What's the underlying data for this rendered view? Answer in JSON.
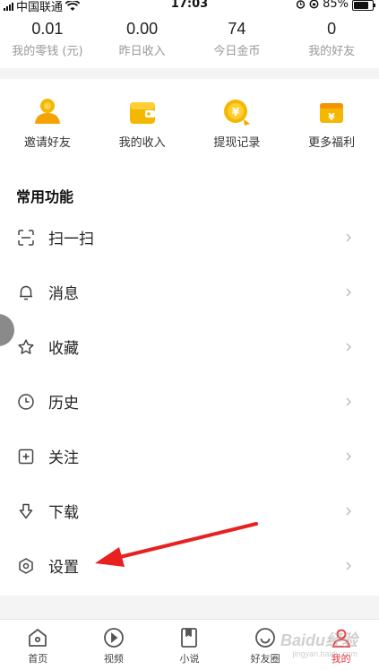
{
  "status_bar": {
    "carrier": "中国联通",
    "time": "17:03",
    "battery": "85%"
  },
  "stats": [
    {
      "value": "0.01",
      "label": "我的零钱 (元)"
    },
    {
      "value": "0.00",
      "label": "昨日收入"
    },
    {
      "value": "74",
      "label": "今日金币"
    },
    {
      "value": "0",
      "label": "我的好友"
    }
  ],
  "features": [
    {
      "label": "邀请好友",
      "icon": "invite-friend-icon"
    },
    {
      "label": "我的收入",
      "icon": "wallet-icon"
    },
    {
      "label": "提现记录",
      "icon": "withdraw-coin-icon"
    },
    {
      "label": "更多福利",
      "icon": "gift-box-icon"
    }
  ],
  "section_title": "常用功能",
  "menu": [
    {
      "label": "扫一扫",
      "icon": "scan-icon"
    },
    {
      "label": "消息",
      "icon": "bell-icon"
    },
    {
      "label": "收藏",
      "icon": "star-icon"
    },
    {
      "label": "历史",
      "icon": "clock-icon"
    },
    {
      "label": "关注",
      "icon": "plus-square-icon"
    },
    {
      "label": "下载",
      "icon": "download-icon"
    },
    {
      "label": "设置",
      "icon": "gear-icon"
    }
  ],
  "tabs": [
    {
      "label": "首页",
      "icon": "home-icon"
    },
    {
      "label": "视频",
      "icon": "play-icon"
    },
    {
      "label": "小说",
      "icon": "book-icon"
    },
    {
      "label": "好友圈",
      "icon": "smile-icon"
    },
    {
      "label": "我的",
      "icon": "profile-icon",
      "active": true
    }
  ],
  "watermark": {
    "text": "Baidu经验",
    "sub": "jingyan.baidu.com"
  },
  "colors": {
    "accent": "#f5b800",
    "active_tab": "#e33333",
    "arrow": "#e82020"
  }
}
